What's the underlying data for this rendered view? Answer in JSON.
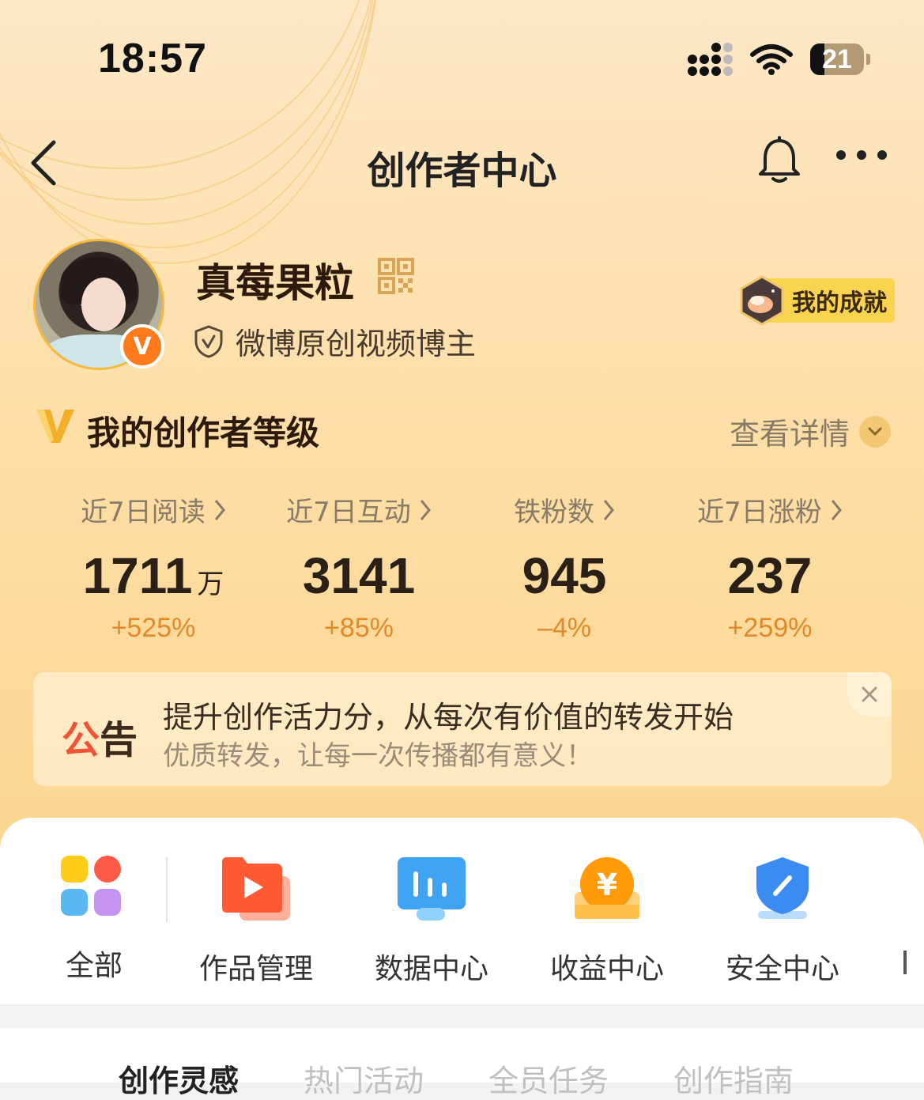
{
  "status_bar": {
    "time": "18:57",
    "battery": "21",
    "icons": [
      "signal-icon",
      "wifi-icon",
      "battery-icon"
    ]
  },
  "nav": {
    "title": "创作者中心",
    "icons": [
      "back-arrow-icon",
      "bell-icon",
      "more-icon"
    ]
  },
  "profile": {
    "name": "真莓果粒",
    "badge": "V",
    "certification": "微博原创视频博主",
    "achievement": "我的成就"
  },
  "level": {
    "title": "我的创作者等级",
    "detail_link": "查看详情"
  },
  "stats": [
    {
      "label": "近7日阅读",
      "value": "1711",
      "unit": "万",
      "change": "+525%"
    },
    {
      "label": "近7日互动",
      "value": "3141",
      "unit": "",
      "change": "+85%"
    },
    {
      "label": "铁粉数",
      "value": "945",
      "unit": "",
      "change": "–4%"
    },
    {
      "label": "近7日涨粉",
      "value": "237",
      "unit": "",
      "change": "+259%"
    }
  ],
  "notice": {
    "tag_part1": "公",
    "tag_part2": "告",
    "title": "提升创作活力分，从每次有价值的转发开始",
    "subtitle": "优质转发，让每一次传播都有意义！"
  },
  "apps": [
    {
      "label": "全部",
      "icon": "all-apps-icon"
    },
    {
      "label": "作品管理",
      "icon": "works-management-icon"
    },
    {
      "label": "数据中心",
      "icon": "data-center-icon"
    },
    {
      "label": "收益中心",
      "icon": "revenue-center-icon"
    },
    {
      "label": "安全中心",
      "icon": "security-center-icon"
    }
  ],
  "tabs": [
    "创作灵感",
    "热门活动",
    "全员任务",
    "创作指南"
  ],
  "colors": {
    "accent_orange": "#ff7a1a",
    "change_orange": "#e08a2a",
    "notice_red": "#ef5436"
  }
}
